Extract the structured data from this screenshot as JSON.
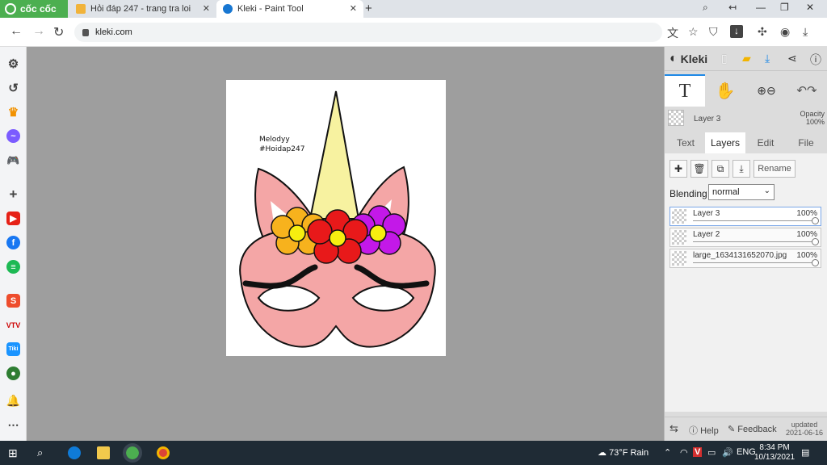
{
  "browser": {
    "brand": "cốc cốc",
    "tabs": [
      {
        "label": "Hỏi đáp 247 - trang tra loi"
      },
      {
        "label": "Kleki - Paint Tool"
      }
    ],
    "url": "kleki.com"
  },
  "canvas": {
    "note_line1": "Melodyy",
    "note_line2": "#Hoidap247"
  },
  "kleki": {
    "app_name": "Kleki",
    "current_layer": "Layer 3",
    "opacity_label": "Opacity",
    "opacity_value": "100%",
    "tabs": [
      "Text",
      "Layers",
      "Edit",
      "File"
    ],
    "rename_label": "Rename",
    "blending_label": "Blending",
    "blending_value": "normal",
    "layers": [
      {
        "name": "Layer 3",
        "opacity": "100%"
      },
      {
        "name": "Layer 2",
        "opacity": "100%"
      },
      {
        "name": "large_1634131652070.jpg",
        "opacity": "100%"
      }
    ],
    "footer": {
      "help": "Help",
      "feedback": "Feedback",
      "updated_label": "updated",
      "updated_date": "2021-06-16"
    }
  },
  "taskbar": {
    "weather": "73°F  Rain",
    "lang": "ENG",
    "time": "8:34 PM",
    "date": "10/13/2021"
  }
}
